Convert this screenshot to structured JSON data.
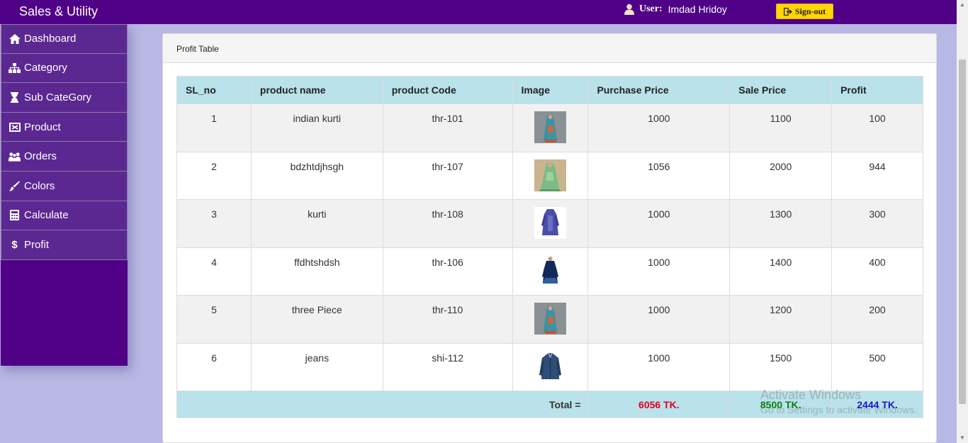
{
  "header": {
    "brand": "Sales & Utility",
    "user_label": "User:",
    "user_name": "Imdad Hridoy",
    "signout_label": "Sign-out"
  },
  "sidebar": {
    "items": [
      {
        "label": "Dashboard",
        "icon": "home-icon"
      },
      {
        "label": "Category",
        "icon": "sitemap-icon"
      },
      {
        "label": "Sub CateGory",
        "icon": "hourglass-icon"
      },
      {
        "label": "Product",
        "icon": "product-icon"
      },
      {
        "label": "Orders",
        "icon": "users-icon"
      },
      {
        "label": "Colors",
        "icon": "paint-brush-icon"
      },
      {
        "label": "Calculate",
        "icon": "calculator-icon"
      },
      {
        "label": "Profit",
        "icon": "dollar-icon"
      }
    ]
  },
  "card": {
    "title": "Profit Table"
  },
  "table": {
    "columns": [
      "SL_no",
      "product name",
      "product Code",
      "Image",
      "Purchase Price",
      "Sale Price",
      "Profit"
    ],
    "rows": [
      {
        "sl": "1",
        "name": "indian kurti",
        "code": "thr-101",
        "image": "product-image-kurti",
        "purchase": "1000",
        "sale": "1100",
        "profit": "100"
      },
      {
        "sl": "2",
        "name": "bdzhtdjhsgh",
        "code": "thr-107",
        "image": "product-image-green-dress",
        "purchase": "1056",
        "sale": "2000",
        "profit": "944"
      },
      {
        "sl": "3",
        "name": "kurti",
        "code": "thr-108",
        "image": "product-image-blue-kurti",
        "purchase": "1000",
        "sale": "1300",
        "profit": "300"
      },
      {
        "sl": "4",
        "name": "ffdhtshdsh",
        "code": "thr-106",
        "image": "product-image-navy-dress",
        "purchase": "1000",
        "sale": "1400",
        "profit": "400"
      },
      {
        "sl": "5",
        "name": "three Piece",
        "code": "thr-110",
        "image": "product-image-three-piece",
        "purchase": "1000",
        "sale": "1200",
        "profit": "200"
      },
      {
        "sl": "6",
        "name": "jeans",
        "code": "shi-112",
        "image": "product-image-denim-shirt",
        "purchase": "1000",
        "sale": "1500",
        "profit": "500"
      }
    ],
    "footer": {
      "label": "Total =",
      "purchase_total": "6056 TK.",
      "sale_total": "8500 TK.",
      "profit_total": "2444 TK."
    }
  },
  "watermark": {
    "line1": "Activate Windows",
    "line2": "Go to Settings to activate Windows."
  },
  "colors": {
    "brand_purple": "#4f0087",
    "sidebar_item": "#5b2891",
    "table_header": "#b9e2ea",
    "signout_yellow": "#ffd500",
    "purchase_total": "#e1001e",
    "sale_total": "#0b7d12",
    "profit_total": "#1414d6"
  }
}
